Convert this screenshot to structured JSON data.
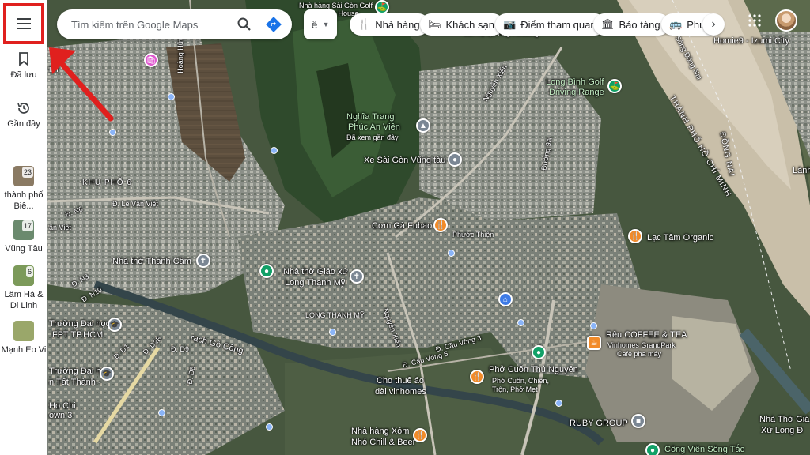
{
  "rail": {
    "saved_label": "Đã lưu",
    "recent_label": "Gần đây",
    "recent_places": [
      {
        "label": "thành phố Biê...",
        "badge": "23",
        "color": "#8a7a63"
      },
      {
        "label": "Vũng Tàu",
        "badge": "17",
        "color": "#6b8a6e"
      },
      {
        "label": "Lâm Hà & Di Linh",
        "badge": "6",
        "color": "#7c9a5a"
      },
      {
        "label": "Mạnh Eo Vi",
        "badge": "",
        "color": "#9aa76a"
      }
    ]
  },
  "search": {
    "placeholder": "Tìm kiếm trên Google Maps"
  },
  "layer": {
    "value": "ê"
  },
  "chips": [
    {
      "label": "Nhà hàng",
      "icon": "fork-knife-icon"
    },
    {
      "label": "Khách sạn",
      "icon": "bed-icon"
    },
    {
      "label": "Điểm tham quan",
      "icon": "camera-icon"
    },
    {
      "label": "Bảo tàng",
      "icon": "museum-icon"
    },
    {
      "label": "Phươ",
      "icon": "bus-icon"
    }
  ],
  "map_labels": {
    "khu_pho": "KHU PHỐ 6",
    "le_van_viet": "Đ. Lê Văn Việt",
    "van_viet": "ăn Việt",
    "nha_tho_thanh_cam": "Nhà thờ Thánh Cầm",
    "nha_tho_giao_xu": "Nhà thờ Giáo xứ",
    "long_thanh_my": "Long Thạnh Mỹ",
    "long_thanh_my_area": "LONG THẠNH MỸ",
    "nghia_trang": "Nghĩa Trang",
    "phuc_an_vien": "Phúc An Viên",
    "da_xem": "Đã xem gần đây",
    "xe_sai_gon": "Xe Sài Gòn Vũng tàu",
    "com_ga": "Cơm Gà Fubao",
    "phuoc_thien": "Phước Thiện",
    "lac_tam": "Lạc Tâm Organic",
    "long_binh_golf": "Long Bình Golf",
    "driving_range": "Driving Range",
    "homie": "Homie9 - Izumi City",
    "dong_nai": "ĐỒNG NAI",
    "tphcm": "THÀNH PHỐ HỒ CHÍ MINH",
    "song_dong_nai": "Sông Đồng Nai",
    "lanh": "Lành",
    "reu_coffee": "Rêu COFFEE & TEA",
    "vinhomes_grandpark": "Vinhomes GrandPark",
    "cafe_pha_may": "Cafe pha máy",
    "pho_cuon": "Phở Cuốn Thủ Nguyên",
    "pho_cuon_sub1": "Phở Cuốn, Chiên,",
    "pho_cuon_sub2": "Trộn, Phở Mẹt",
    "cho_thue": "Cho thuê áo",
    "dai_vinhomes": "dài vinhomes",
    "nha_hang_xom": "Nhà hàng Xóm",
    "nho_chill": "Nhỏ Chill & Beer",
    "ruby_group": "RUBY GROUP",
    "cong_vien": "Công Viên Sông Tắc",
    "nha_tho_giao_xu_long": "Nhà Thờ Giá",
    "xu_long": "Xứ Long Đ",
    "truong_fpt": "Trường Đại học",
    "fpt_hcm": "FPT TP.HCM",
    "truong_ntt": "Trường Đại học",
    "ntt": "n Tất Thành -",
    "ho_chi": "Ho Chi",
    "minh3": "own 3",
    "rach_go_cong": "rạch Gò Công",
    "cau_vong3": "Đ. Cầu Vòng 3",
    "cau_vong5": "Đ. Cầu Vòng 5",
    "nguyen_xien": "Nguyễn Xiển",
    "nguyen_xien2": "Nguyễn Xiển",
    "d_d1": "Đ. D1",
    "d_d2b": "Đ. D2B",
    "d_d9": "Đ. D9",
    "d_d8": "Đ. D8",
    "d_n6": "Đ. N6",
    "d_n3": "Đ. N3",
    "d_n10": "Đ. N10",
    "hoang_huu": "Hoàng Hữu N",
    "duong9a": "Đường 9A",
    "nha_hang_sai_gon_golf": "Nhà hàng Sài Gòn Golf",
    "house": "n House",
    "ray_housing": "căn hộ lạc Ray Housing",
    "im": "im"
  }
}
